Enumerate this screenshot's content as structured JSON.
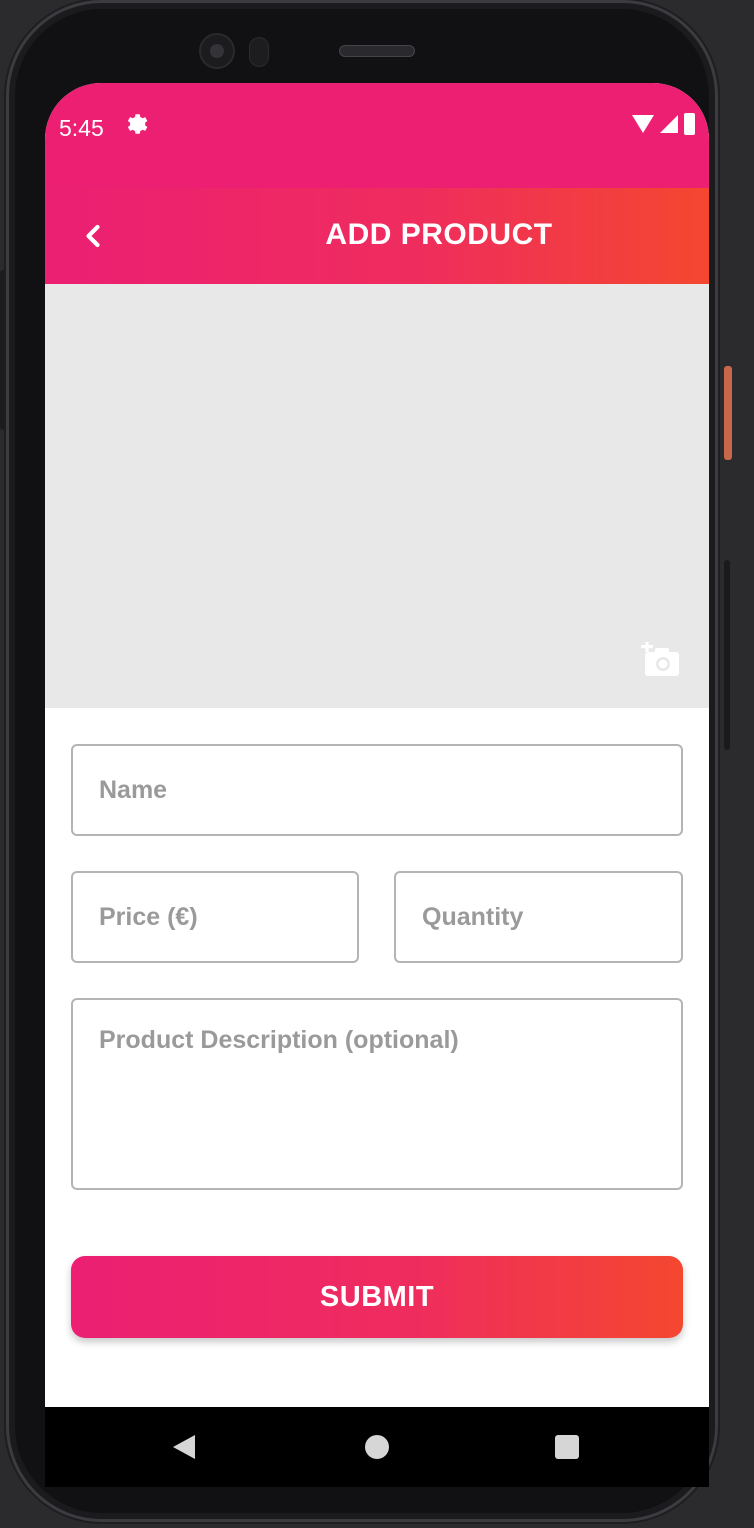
{
  "status_bar": {
    "time": "5:45"
  },
  "app_bar": {
    "back_icon": "chevron-left-icon",
    "title": "ADD PRODUCT",
    "background_gradient": [
      "#ec1f73",
      "#f4472f"
    ]
  },
  "image_picker": {
    "icon": "add-photo-icon",
    "background": "#e8e8e8"
  },
  "form": {
    "name_placeholder": "Name",
    "price_placeholder": "Price (€)",
    "quantity_placeholder": "Quantity",
    "description_placeholder": "Product Description (optional)",
    "submit_label": "SUBMIT"
  },
  "nav_bar": {
    "back_icon": "triangle-back-icon",
    "home_icon": "circle-home-icon",
    "recents_icon": "square-recents-icon"
  }
}
